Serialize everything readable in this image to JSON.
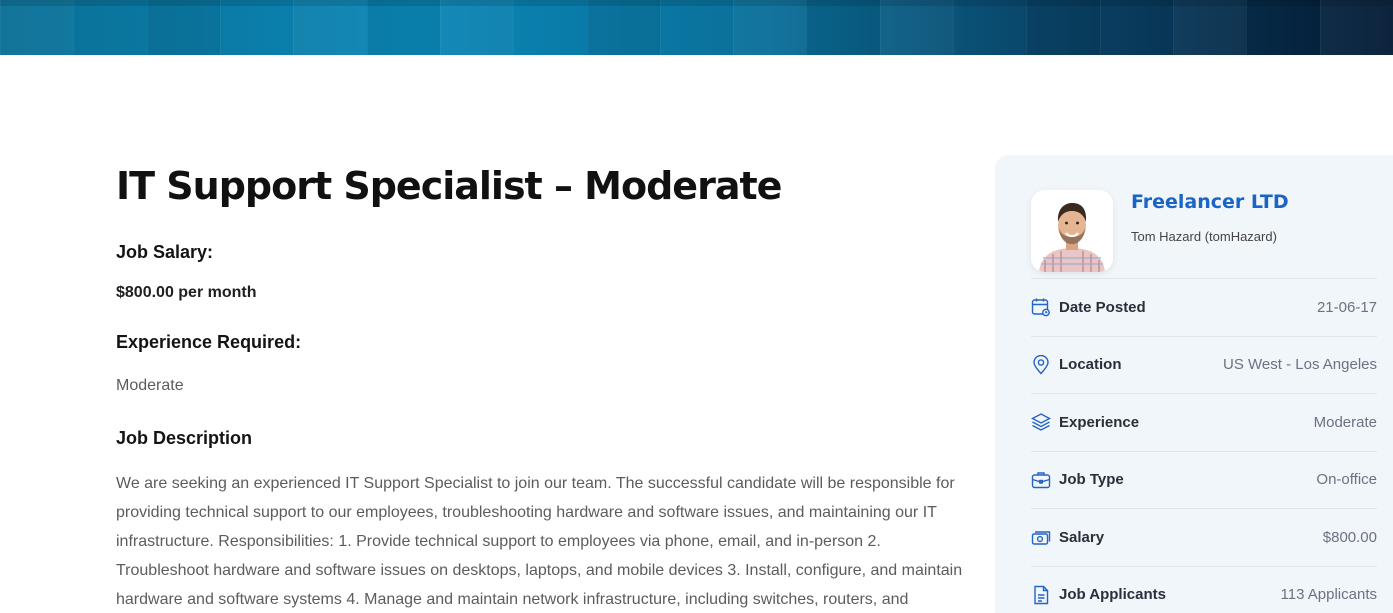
{
  "job": {
    "title": "IT Support Specialist – Moderate",
    "salary_label": "Job Salary:",
    "salary_value": "$800.00 per month",
    "experience_label": "Experience Required:",
    "experience_value": "Moderate",
    "description_label": "Job Description",
    "description_text": "We are seeking an experienced IT Support Specialist to join our team. The successful candidate will be responsible for providing technical support to our employees, troubleshooting hardware and software issues, and maintaining our IT infrastructure. Responsibilities: 1. Provide technical support to employees via phone, email, and in-person 2. Troubleshoot hardware and software issues on desktops, laptops, and mobile devices 3. Install, configure, and maintain hardware and software systems 4. Manage and maintain network infrastructure, including switches, routers, and"
  },
  "sidebar": {
    "company_name": "Freelancer LTD",
    "poster": "Tom Hazard (tomHazard)",
    "details": [
      {
        "icon": "calendar-icon",
        "label": "Date Posted",
        "value": "21-06-17"
      },
      {
        "icon": "location-pin-icon",
        "label": "Location",
        "value": "US West - Los Angeles"
      },
      {
        "icon": "layers-icon",
        "label": "Experience",
        "value": "Moderate"
      },
      {
        "icon": "briefcase-icon",
        "label": "Job Type",
        "value": "On-office"
      },
      {
        "icon": "money-icon",
        "label": "Salary",
        "value": "$800.00"
      },
      {
        "icon": "document-icon",
        "label": "Job Applicants",
        "value": "113 Applicants"
      }
    ]
  },
  "colors": {
    "accent": "#1a64c8",
    "banner_start": "#0a6f95",
    "banner_end": "#051c36",
    "sidebar_bg": "#f1f6fb"
  }
}
